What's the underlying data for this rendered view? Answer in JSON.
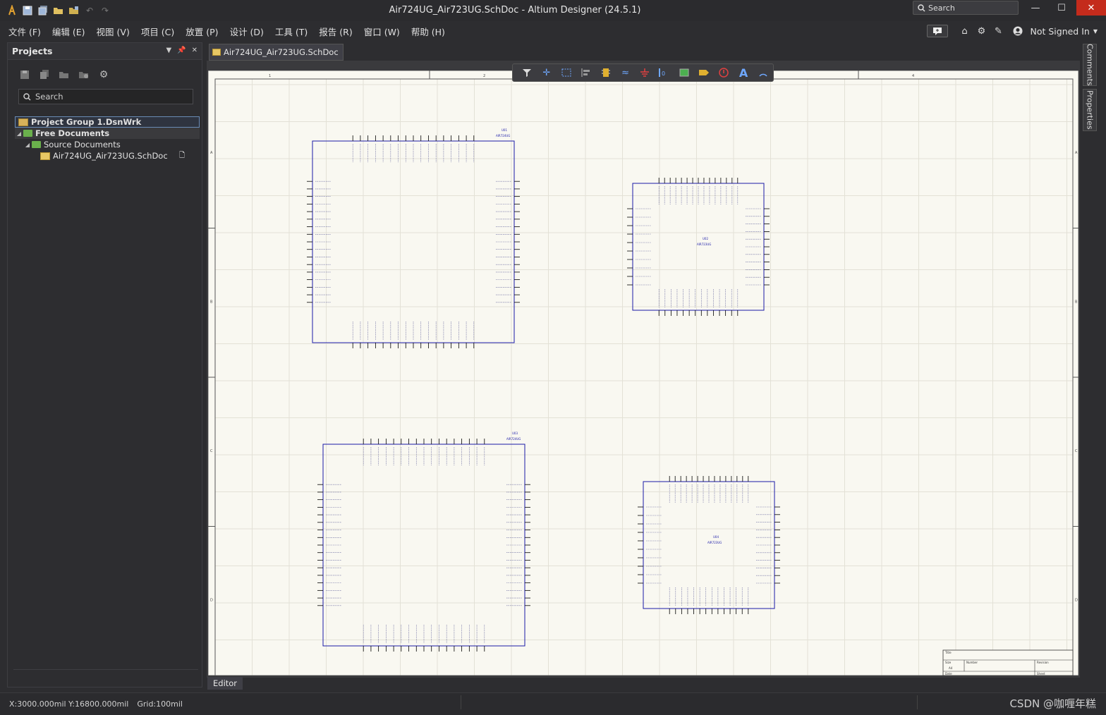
{
  "window": {
    "title": "Air724UG_Air723UG.SchDoc - Altium Designer (24.5.1)",
    "search_placeholder": "Search",
    "minimize": "—",
    "maximize": "☐",
    "close": "✕"
  },
  "menu": {
    "items": [
      "文件 (F)",
      "编辑 (E)",
      "视图 (V)",
      "项目 (C)",
      "放置 (P)",
      "设计 (D)",
      "工具 (T)",
      "报告 (R)",
      "窗口 (W)",
      "帮助 (H)"
    ],
    "user": "Not Signed In"
  },
  "projects_panel": {
    "title": "Projects",
    "search_placeholder": "Search",
    "tree": {
      "project_group": "Project Group 1.DsnWrk",
      "free_documents": "Free Documents",
      "source_documents": "Source Documents",
      "document": "Air724UG_Air723UG.SchDoc"
    }
  },
  "document_tab": "Air724UG_Air723UG.SchDoc",
  "editor_tab": "Editor",
  "side_panels": [
    "Comments",
    "Properties"
  ],
  "status": {
    "coordinates": "X:3000.000mil Y:16800.000mil",
    "grid": "Grid:100mil",
    "watermark": "CSDN @咖喱年糕"
  },
  "sheet": {
    "border_columns": [
      "1",
      "2",
      "3",
      "4"
    ],
    "border_rows": [
      "A",
      "B",
      "C",
      "D"
    ],
    "components": [
      {
        "designator": "U01",
        "comment": "AIR724UG"
      },
      {
        "designator": "U02",
        "comment": "AIR723UG"
      },
      {
        "designator": "U03",
        "comment": "AIR724UG"
      },
      {
        "designator": "U04",
        "comment": "AIR723UG"
      }
    ],
    "title_block": {
      "title": "Title",
      "size": "Size",
      "size_value": "A4",
      "number": "Number",
      "revision": "Revision",
      "date": "Date",
      "sheet": "Sheet"
    }
  },
  "colors": {
    "component_border": "#1a1aa8",
    "sheet_background": "#f9f8f1",
    "grid_line": "#e3e1d6",
    "selection": "#2f5f8f",
    "close_button": "#c42b1c"
  }
}
